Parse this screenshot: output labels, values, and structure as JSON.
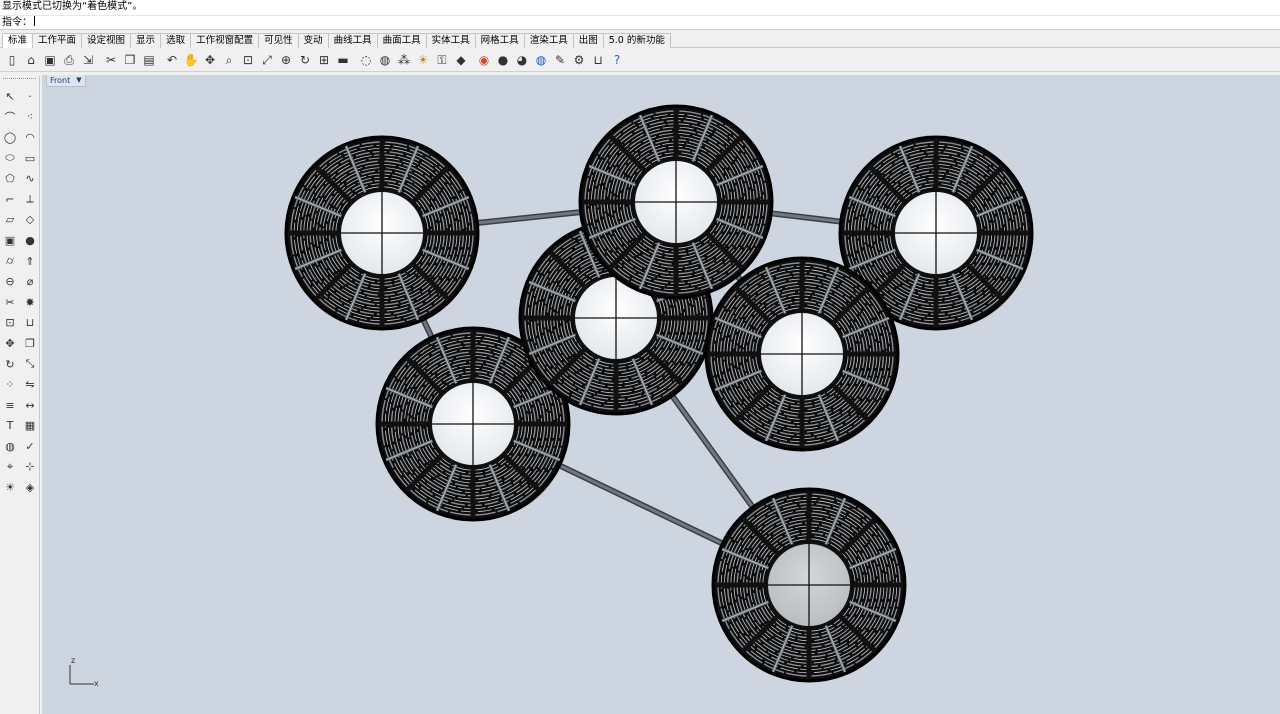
{
  "status": {
    "message": "显示模式已切换为“着色模式”。"
  },
  "command": {
    "prompt": "指令："
  },
  "tabs": [
    {
      "label": "标准",
      "active": true
    },
    {
      "label": "工作平面"
    },
    {
      "label": "设定视图"
    },
    {
      "label": "显示"
    },
    {
      "label": "选取"
    },
    {
      "label": "工作视窗配置"
    },
    {
      "label": "可见性"
    },
    {
      "label": "变动"
    },
    {
      "label": "曲线工具"
    },
    {
      "label": "曲面工具"
    },
    {
      "label": "实体工具"
    },
    {
      "label": "网格工具"
    },
    {
      "label": "渲染工具"
    },
    {
      "label": "出图"
    },
    {
      "label": "5.0 的新功能"
    }
  ],
  "toolbar": {
    "icons": [
      "new-file-icon",
      "open-folder-icon",
      "save-icon",
      "print-icon",
      "import-icon",
      "cut-icon",
      "copy-icon",
      "paste-icon",
      "undo-icon",
      "pan-hand-icon",
      "move-view-icon",
      "zoom-icon",
      "zoom-window-icon",
      "zoom-extents-icon",
      "zoom-selected-icon",
      "rotate-view-icon",
      "four-viewports-icon",
      "car-icon",
      "hide-icon",
      "show-icon",
      "points-on-icon",
      "lightbulb-icon",
      "lock-icon",
      "layer-icon",
      "color-wheel-icon",
      "sphere-icon",
      "shaded-sphere-icon",
      "render-sphere-icon",
      "tools-icon",
      "settings-gear-icon",
      "join-icon",
      "help-icon"
    ]
  },
  "sidebar": {
    "icons": [
      "select-arrow-icon",
      "point-icon",
      "polyline-icon",
      "curve-points-icon",
      "circle-icon",
      "arc-icon",
      "ellipse-icon",
      "rectangle-icon",
      "polygon-icon",
      "freeform-icon",
      "fillet-icon",
      "offset-icon",
      "surface-icon",
      "loft-icon",
      "box-icon",
      "sphere-icon",
      "cylinder-icon",
      "extrude-icon",
      "boolean-icon",
      "split-icon",
      "trim-icon",
      "explode-icon",
      "group-icon",
      "join-icon",
      "move-icon",
      "copy-icon",
      "rotate-icon",
      "scale-icon",
      "array-icon",
      "mirror-icon",
      "align-icon",
      "dimension-icon",
      "text-icon",
      "mesh-icon",
      "render-icon",
      "check-icon",
      "analyze-icon",
      "snap-icon",
      "light-icon",
      "material-icon"
    ]
  },
  "viewport": {
    "label": "Front",
    "axis_x": "x",
    "axis_z": "z",
    "colors": {
      "background": "#cdd6e0",
      "ring": "#0d0d0d",
      "rod": "#6f7780"
    }
  }
}
